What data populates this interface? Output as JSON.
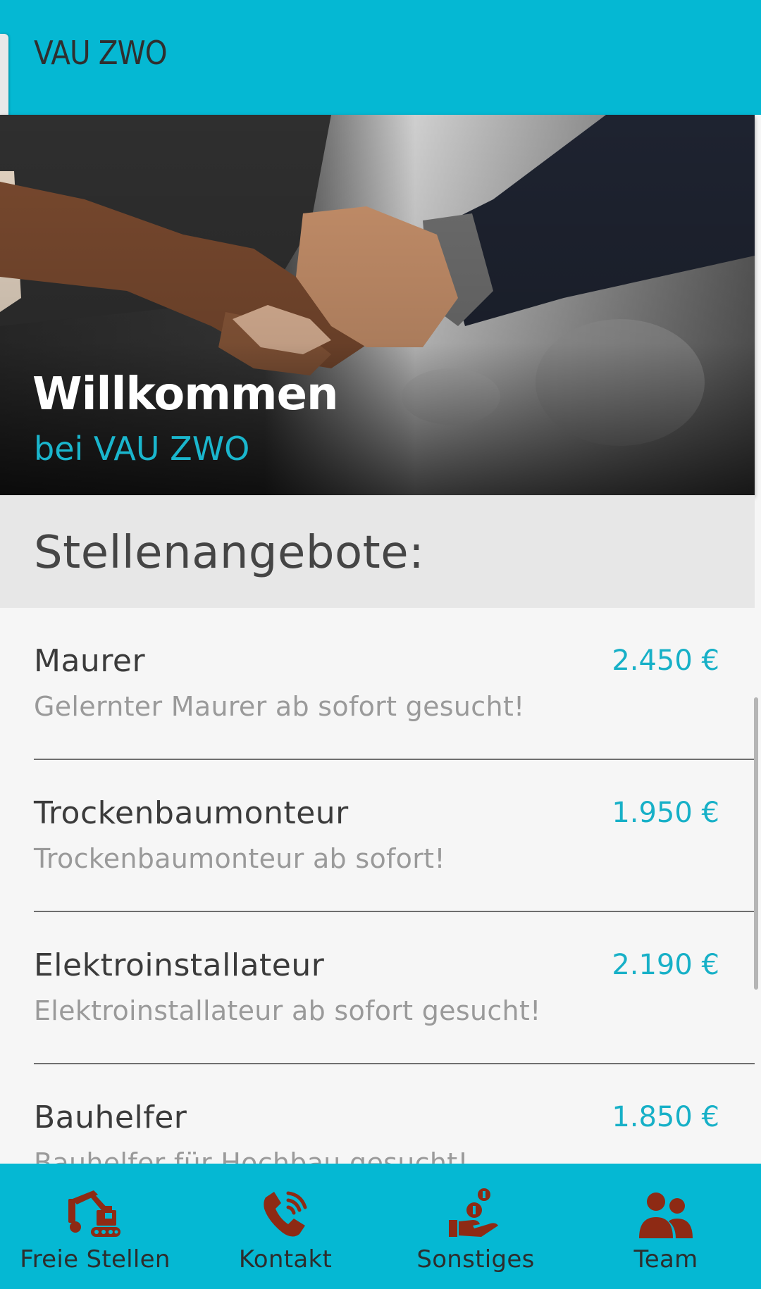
{
  "app_bar": {
    "title": "VAU ZWO"
  },
  "hero": {
    "title": "Willkommen",
    "subtitle": "bei VAU ZWO"
  },
  "jobs_section": {
    "title": "Stellenangebote:",
    "jobs": [
      {
        "title": "Maurer",
        "description": "Gelernter Maurer ab sofort gesucht!",
        "salary": "2.450 €"
      },
      {
        "title": "Trockenbaumonteur",
        "description": "Trockenbaumonteur ab sofort!",
        "salary": "1.950 €"
      },
      {
        "title": "Elektroinstallateur",
        "description": "Elektroinstallateur ab sofort gesucht!",
        "salary": "2.190 €"
      },
      {
        "title": "Bauhelfer",
        "description": "Bauhelfer für Hochbau gesucht!",
        "salary": "1.850 €"
      }
    ]
  },
  "bottom_nav": {
    "items": [
      {
        "label": "Freie Stellen",
        "icon": "excavator-icon"
      },
      {
        "label": "Kontakt",
        "icon": "phone-icon"
      },
      {
        "label": "Sonstiges",
        "icon": "hand-coin-icon"
      },
      {
        "label": "Team",
        "icon": "team-icon"
      }
    ]
  },
  "colors": {
    "primary": "#05b8d3",
    "accent_text": "#17b0c7",
    "icon": "#8e2a14"
  }
}
